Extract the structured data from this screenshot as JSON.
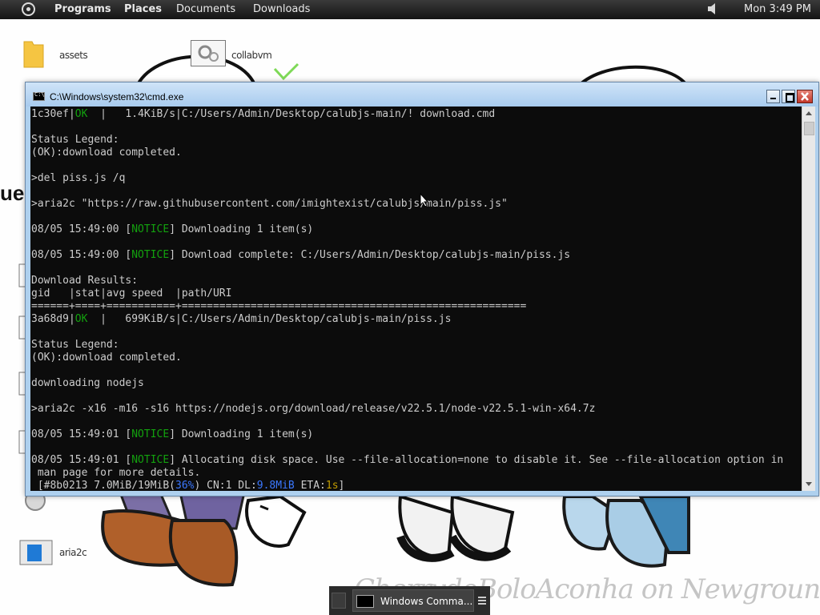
{
  "top_panel": {
    "menus": [
      "Programs",
      "Places",
      "Documents",
      "Downloads"
    ],
    "clock": "Mon 3:49 PM"
  },
  "desktop": {
    "icons": [
      {
        "label": "assets",
        "icon": "folder-icon"
      },
      {
        "label": "collabvm",
        "icon": "cog-icon"
      },
      {
        "label": "aria2c",
        "icon": "window-icon"
      }
    ],
    "watermark": "CherrydoBoloAconha on Newgrounds."
  },
  "cmd_window": {
    "title": "C:\\Windows\\system32\\cmd.exe",
    "colors": {
      "background": "#0c0c0c",
      "text": "#cccccc",
      "green": "#13a10e",
      "blue": "#3b78ff",
      "red": "#c50f1f",
      "yellow": "#c19c00"
    },
    "lines": [
      [
        {
          "t": "1c30ef|"
        },
        {
          "t": "OK",
          "c": "green"
        },
        {
          "t": "  |   1.4KiB/s|C:/Users/Admin/Desktop/calubjs-main/! download.cmd"
        }
      ],
      [],
      [
        {
          "t": "Status Legend:"
        }
      ],
      [
        {
          "t": "(OK):download completed."
        }
      ],
      [],
      [
        {
          "t": ">del piss.js /q"
        }
      ],
      [],
      [
        {
          "t": ">aria2c \"https://raw.githubusercontent.com/imightexist/calubjs/main/piss.js\""
        }
      ],
      [],
      [
        {
          "t": "08/05 15:49:00 ["
        },
        {
          "t": "NOTICE",
          "c": "green"
        },
        {
          "t": "] Downloading 1 item(s)"
        }
      ],
      [],
      [
        {
          "t": "08/05 15:49:00 ["
        },
        {
          "t": "NOTICE",
          "c": "green"
        },
        {
          "t": "] Download complete: C:/Users/Admin/Desktop/calubjs-main/piss.js"
        }
      ],
      [],
      [
        {
          "t": "Download Results:"
        }
      ],
      [
        {
          "t": "gid   |stat|avg speed  |path/URI"
        }
      ],
      [
        {
          "t": "======+====+===========+======================================================="
        }
      ],
      [
        {
          "t": "3a68d9|"
        },
        {
          "t": "OK",
          "c": "green"
        },
        {
          "t": "  |   699KiB/s|C:/Users/Admin/Desktop/calubjs-main/piss.js"
        }
      ],
      [],
      [
        {
          "t": "Status Legend:"
        }
      ],
      [
        {
          "t": "(OK):download completed."
        }
      ],
      [],
      [
        {
          "t": "downloading nodejs"
        }
      ],
      [],
      [
        {
          "t": ">aria2c -x16 -m16 -s16 https://nodejs.org/download/release/v22.5.1/node-v22.5.1-win-x64.7z"
        }
      ],
      [],
      [
        {
          "t": "08/05 15:49:01 ["
        },
        {
          "t": "NOTICE",
          "c": "green"
        },
        {
          "t": "] Downloading 1 item(s)"
        }
      ],
      [],
      [
        {
          "t": "08/05 15:49:01 ["
        },
        {
          "t": "NOTICE",
          "c": "green"
        },
        {
          "t": "] Allocating disk space. Use --file-allocation=none to disable it. See --file-allocation option in"
        }
      ],
      [
        {
          "t": " man page for more details."
        }
      ],
      [
        {
          "t": " [#8b0213 7.0MiB/19MiB("
        },
        {
          "t": "36%",
          "c": "blue"
        },
        {
          "t": ") CN:1 DL:"
        },
        {
          "t": "9.8MiB",
          "c": "blue"
        },
        {
          "t": " ETA:"
        },
        {
          "t": "1s",
          "c": "yellow"
        },
        {
          "t": "]"
        }
      ]
    ]
  },
  "taskbar": {
    "task_label": "Windows Comma..."
  }
}
